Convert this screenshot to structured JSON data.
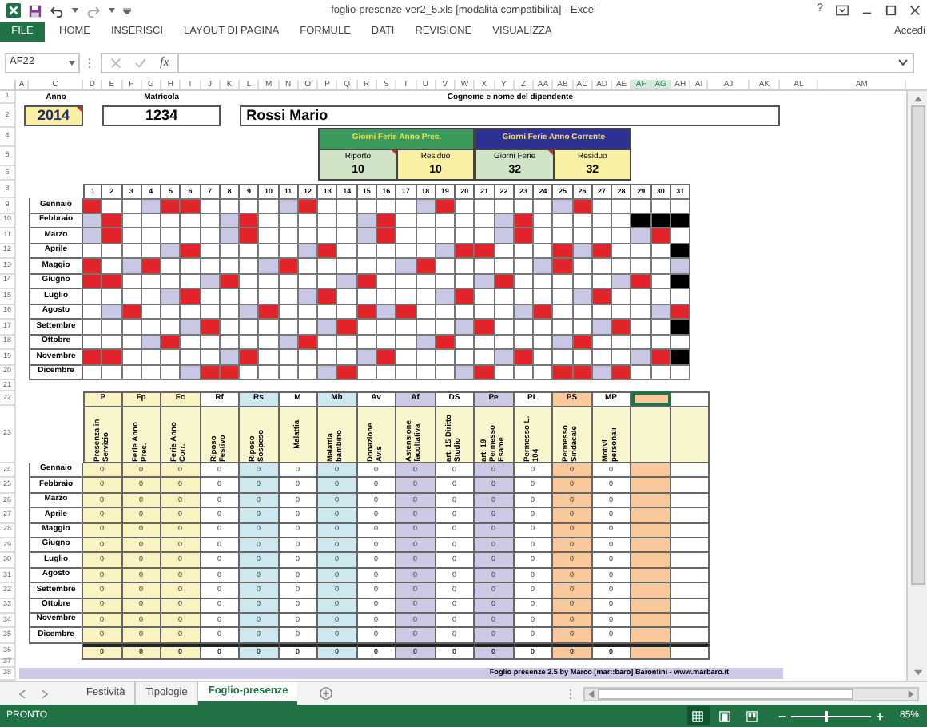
{
  "window": {
    "title": "foglio-presenze-ver2_5.xls  [modalità compatibilità] - Excel",
    "help": "?"
  },
  "ribbon": {
    "file_tab": "FILE",
    "tabs": [
      "HOME",
      "INSERISCI",
      "LAYOUT DI PAGINA",
      "FORMULE",
      "DATI",
      "REVISIONE",
      "VISUALIZZA"
    ],
    "account": "Accedi"
  },
  "formula_bar": {
    "name_box": "AF22",
    "function_label": "fx"
  },
  "columns": [
    {
      "label": "A",
      "selected": false
    },
    {
      "label": "C",
      "selected": false
    },
    {
      "label": "D",
      "selected": false
    },
    {
      "label": "E",
      "selected": false
    },
    {
      "label": "F",
      "selected": false
    },
    {
      "label": "G",
      "selected": false
    },
    {
      "label": "H",
      "selected": false
    },
    {
      "label": "I",
      "selected": false
    },
    {
      "label": "J",
      "selected": false
    },
    {
      "label": "K",
      "selected": false
    },
    {
      "label": "L",
      "selected": false
    },
    {
      "label": "M",
      "selected": false
    },
    {
      "label": "N",
      "selected": false
    },
    {
      "label": "O",
      "selected": false
    },
    {
      "label": "P",
      "selected": false
    },
    {
      "label": "Q",
      "selected": false
    },
    {
      "label": "R",
      "selected": false
    },
    {
      "label": "S",
      "selected": false
    },
    {
      "label": "T",
      "selected": false
    },
    {
      "label": "U",
      "selected": false
    },
    {
      "label": "V",
      "selected": false
    },
    {
      "label": "W",
      "selected": false
    },
    {
      "label": "X",
      "selected": false
    },
    {
      "label": "Y",
      "selected": false
    },
    {
      "label": "Z",
      "selected": false
    },
    {
      "label": "AA",
      "selected": false
    },
    {
      "label": "AB",
      "selected": false
    },
    {
      "label": "AC",
      "selected": false
    },
    {
      "label": "AD",
      "selected": false
    },
    {
      "label": "AE",
      "selected": false
    },
    {
      "label": "AF",
      "selected": true
    },
    {
      "label": "AG",
      "selected": true
    },
    {
      "label": "AH",
      "selected": false
    },
    {
      "label": "AI",
      "selected": false
    },
    {
      "label": "AJ",
      "selected": false
    },
    {
      "label": "AK",
      "selected": false
    },
    {
      "label": "AL",
      "selected": false
    },
    {
      "label": "AM",
      "selected": false
    }
  ],
  "row_numbers": [
    "1",
    "2",
    "4",
    "5",
    "6",
    "8",
    "9",
    "10",
    "11",
    "12",
    "13",
    "14",
    "15",
    "16",
    "17",
    "18",
    "19",
    "20",
    "21",
    "22",
    "23",
    "24",
    "25",
    "26",
    "27",
    "28",
    "29",
    "30",
    "31",
    "32",
    "33",
    "34",
    "35",
    "36",
    "37",
    "38"
  ],
  "header": {
    "anno": {
      "label": "Anno",
      "value": "2014",
      "comment": true
    },
    "matricola": {
      "label": "Matricola",
      "value": "1234"
    },
    "dipendente": {
      "label": "Cognome e nome del dipendente",
      "value": "Rossi Mario"
    }
  },
  "ferie": [
    {
      "title": "Giorni Ferie Anno Prec.",
      "color": "#3a9a5b",
      "fields": [
        {
          "label": "Riporto",
          "value": "10",
          "color": "#cfe3c6",
          "comment": true
        },
        {
          "label": "Residuo",
          "value": "10",
          "color": "#f7f0a3",
          "comment": false
        }
      ]
    },
    {
      "title": "Giorni Ferie Anno Corrente",
      "color": "#2e3192",
      "fields": [
        {
          "label": "Giorni Ferie",
          "value": "32",
          "color": "#cfe3c6",
          "comment": true
        },
        {
          "label": "Residuo",
          "value": "32",
          "color": "#f7f0a3",
          "comment": false
        }
      ]
    }
  ],
  "calendar": {
    "days": [
      "1",
      "2",
      "3",
      "4",
      "5",
      "6",
      "7",
      "8",
      "9",
      "10",
      "11",
      "12",
      "13",
      "14",
      "15",
      "16",
      "17",
      "18",
      "19",
      "20",
      "21",
      "22",
      "23",
      "24",
      "25",
      "26",
      "27",
      "28",
      "29",
      "30",
      "31"
    ],
    "months": [
      {
        "name": "Gennaio",
        "days": [
          {
            "kind": "hol"
          },
          {
            "kind": "work"
          },
          {
            "kind": "work"
          },
          {
            "kind": "sat"
          },
          {
            "kind": "hol"
          },
          {
            "kind": "hol"
          },
          {
            "kind": "work"
          },
          {
            "kind": "work"
          },
          {
            "kind": "work"
          },
          {
            "kind": "work"
          },
          {
            "kind": "sat"
          },
          {
            "kind": "hol"
          },
          {
            "kind": "work"
          },
          {
            "kind": "work"
          },
          {
            "kind": "work"
          },
          {
            "kind": "work"
          },
          {
            "kind": "work"
          },
          {
            "kind": "sat"
          },
          {
            "kind": "hol"
          },
          {
            "kind": "work"
          },
          {
            "kind": "work"
          },
          {
            "kind": "work"
          },
          {
            "kind": "work"
          },
          {
            "kind": "work"
          },
          {
            "kind": "sat"
          },
          {
            "kind": "hol"
          },
          {
            "kind": "work"
          },
          {
            "kind": "work"
          },
          {
            "kind": "work"
          },
          {
            "kind": "work"
          },
          {
            "kind": "work"
          }
        ]
      },
      {
        "name": "Febbraio",
        "days": [
          {
            "kind": "sat"
          },
          {
            "kind": "hol"
          },
          {
            "kind": "work"
          },
          {
            "kind": "work"
          },
          {
            "kind": "work"
          },
          {
            "kind": "work"
          },
          {
            "kind": "work"
          },
          {
            "kind": "sat"
          },
          {
            "kind": "hol"
          },
          {
            "kind": "work"
          },
          {
            "kind": "work"
          },
          {
            "kind": "work"
          },
          {
            "kind": "work"
          },
          {
            "kind": "work"
          },
          {
            "kind": "sat"
          },
          {
            "kind": "hol"
          },
          {
            "kind": "work"
          },
          {
            "kind": "work"
          },
          {
            "kind": "work"
          },
          {
            "kind": "work"
          },
          {
            "kind": "work"
          },
          {
            "kind": "sat"
          },
          {
            "kind": "hol"
          },
          {
            "kind": "work"
          },
          {
            "kind": "work"
          },
          {
            "kind": "work"
          },
          {
            "kind": "work"
          },
          {
            "kind": "work"
          },
          {
            "kind": "none"
          },
          {
            "kind": "none"
          },
          {
            "kind": "none"
          }
        ]
      },
      {
        "name": "Marzo",
        "days": [
          {
            "kind": "sat"
          },
          {
            "kind": "hol"
          },
          {
            "kind": "work"
          },
          {
            "kind": "work"
          },
          {
            "kind": "work"
          },
          {
            "kind": "work"
          },
          {
            "kind": "work"
          },
          {
            "kind": "sat"
          },
          {
            "kind": "hol"
          },
          {
            "kind": "work"
          },
          {
            "kind": "work"
          },
          {
            "kind": "work"
          },
          {
            "kind": "work"
          },
          {
            "kind": "work"
          },
          {
            "kind": "sat"
          },
          {
            "kind": "hol"
          },
          {
            "kind": "work"
          },
          {
            "kind": "work"
          },
          {
            "kind": "work"
          },
          {
            "kind": "work"
          },
          {
            "kind": "work"
          },
          {
            "kind": "sat"
          },
          {
            "kind": "hol"
          },
          {
            "kind": "work"
          },
          {
            "kind": "work"
          },
          {
            "kind": "work"
          },
          {
            "kind": "work"
          },
          {
            "kind": "work"
          },
          {
            "kind": "sat"
          },
          {
            "kind": "hol"
          },
          {
            "kind": "work"
          }
        ]
      },
      {
        "name": "Aprile",
        "days": [
          {
            "kind": "work"
          },
          {
            "kind": "work"
          },
          {
            "kind": "work"
          },
          {
            "kind": "work"
          },
          {
            "kind": "sat"
          },
          {
            "kind": "hol"
          },
          {
            "kind": "work"
          },
          {
            "kind": "work"
          },
          {
            "kind": "work"
          },
          {
            "kind": "work"
          },
          {
            "kind": "work"
          },
          {
            "kind": "sat"
          },
          {
            "kind": "hol"
          },
          {
            "kind": "work"
          },
          {
            "kind": "work"
          },
          {
            "kind": "work"
          },
          {
            "kind": "work"
          },
          {
            "kind": "work"
          },
          {
            "kind": "sat"
          },
          {
            "kind": "hol"
          },
          {
            "kind": "hol"
          },
          {
            "kind": "work"
          },
          {
            "kind": "work"
          },
          {
            "kind": "work"
          },
          {
            "kind": "hol"
          },
          {
            "kind": "sat"
          },
          {
            "kind": "hol"
          },
          {
            "kind": "work"
          },
          {
            "kind": "work"
          },
          {
            "kind": "work"
          },
          {
            "kind": "none"
          }
        ]
      },
      {
        "name": "Maggio",
        "days": [
          {
            "kind": "hol"
          },
          {
            "kind": "work"
          },
          {
            "kind": "sat"
          },
          {
            "kind": "hol"
          },
          {
            "kind": "work"
          },
          {
            "kind": "work"
          },
          {
            "kind": "work"
          },
          {
            "kind": "work"
          },
          {
            "kind": "work"
          },
          {
            "kind": "sat"
          },
          {
            "kind": "hol"
          },
          {
            "kind": "work"
          },
          {
            "kind": "work"
          },
          {
            "kind": "work"
          },
          {
            "kind": "work"
          },
          {
            "kind": "work"
          },
          {
            "kind": "sat"
          },
          {
            "kind": "hol"
          },
          {
            "kind": "work"
          },
          {
            "kind": "work"
          },
          {
            "kind": "work"
          },
          {
            "kind": "work"
          },
          {
            "kind": "work"
          },
          {
            "kind": "sat"
          },
          {
            "kind": "hol"
          },
          {
            "kind": "work"
          },
          {
            "kind": "work"
          },
          {
            "kind": "work"
          },
          {
            "kind": "work"
          },
          {
            "kind": "work"
          },
          {
            "kind": "sat"
          }
        ]
      },
      {
        "name": "Giugno",
        "days": [
          {
            "kind": "hol"
          },
          {
            "kind": "hol"
          },
          {
            "kind": "work"
          },
          {
            "kind": "work"
          },
          {
            "kind": "work"
          },
          {
            "kind": "work"
          },
          {
            "kind": "sat"
          },
          {
            "kind": "hol"
          },
          {
            "kind": "work"
          },
          {
            "kind": "work"
          },
          {
            "kind": "work"
          },
          {
            "kind": "work"
          },
          {
            "kind": "work"
          },
          {
            "kind": "sat"
          },
          {
            "kind": "hol"
          },
          {
            "kind": "work"
          },
          {
            "kind": "work"
          },
          {
            "kind": "work"
          },
          {
            "kind": "work"
          },
          {
            "kind": "work"
          },
          {
            "kind": "sat"
          },
          {
            "kind": "hol"
          },
          {
            "kind": "work"
          },
          {
            "kind": "work"
          },
          {
            "kind": "work"
          },
          {
            "kind": "work"
          },
          {
            "kind": "work"
          },
          {
            "kind": "sat"
          },
          {
            "kind": "hol"
          },
          {
            "kind": "work"
          },
          {
            "kind": "none"
          }
        ]
      },
      {
        "name": "Luglio",
        "days": [
          {
            "kind": "work"
          },
          {
            "kind": "work"
          },
          {
            "kind": "work"
          },
          {
            "kind": "work"
          },
          {
            "kind": "sat"
          },
          {
            "kind": "hol"
          },
          {
            "kind": "work"
          },
          {
            "kind": "work"
          },
          {
            "kind": "work"
          },
          {
            "kind": "work"
          },
          {
            "kind": "work"
          },
          {
            "kind": "sat"
          },
          {
            "kind": "hol"
          },
          {
            "kind": "work"
          },
          {
            "kind": "work"
          },
          {
            "kind": "work"
          },
          {
            "kind": "work"
          },
          {
            "kind": "work"
          },
          {
            "kind": "sat"
          },
          {
            "kind": "hol"
          },
          {
            "kind": "work"
          },
          {
            "kind": "work"
          },
          {
            "kind": "work"
          },
          {
            "kind": "work"
          },
          {
            "kind": "work"
          },
          {
            "kind": "sat"
          },
          {
            "kind": "hol"
          },
          {
            "kind": "work"
          },
          {
            "kind": "work"
          },
          {
            "kind": "work"
          },
          {
            "kind": "work"
          }
        ]
      },
      {
        "name": "Agosto",
        "days": [
          {
            "kind": "work"
          },
          {
            "kind": "sat"
          },
          {
            "kind": "hol"
          },
          {
            "kind": "work"
          },
          {
            "kind": "work"
          },
          {
            "kind": "work"
          },
          {
            "kind": "work"
          },
          {
            "kind": "work"
          },
          {
            "kind": "sat"
          },
          {
            "kind": "hol"
          },
          {
            "kind": "work"
          },
          {
            "kind": "work"
          },
          {
            "kind": "work"
          },
          {
            "kind": "work"
          },
          {
            "kind": "hol"
          },
          {
            "kind": "sat"
          },
          {
            "kind": "hol"
          },
          {
            "kind": "work"
          },
          {
            "kind": "work"
          },
          {
            "kind": "work"
          },
          {
            "kind": "work"
          },
          {
            "kind": "work"
          },
          {
            "kind": "sat"
          },
          {
            "kind": "hol"
          },
          {
            "kind": "work"
          },
          {
            "kind": "work"
          },
          {
            "kind": "work"
          },
          {
            "kind": "work"
          },
          {
            "kind": "work"
          },
          {
            "kind": "sat"
          },
          {
            "kind": "hol"
          }
        ]
      },
      {
        "name": "Settembre",
        "days": [
          {
            "kind": "work"
          },
          {
            "kind": "work"
          },
          {
            "kind": "work"
          },
          {
            "kind": "work"
          },
          {
            "kind": "work"
          },
          {
            "kind": "sat"
          },
          {
            "kind": "hol"
          },
          {
            "kind": "work"
          },
          {
            "kind": "work"
          },
          {
            "kind": "work"
          },
          {
            "kind": "work"
          },
          {
            "kind": "work"
          },
          {
            "kind": "sat"
          },
          {
            "kind": "hol"
          },
          {
            "kind": "work"
          },
          {
            "kind": "work"
          },
          {
            "kind": "work"
          },
          {
            "kind": "work"
          },
          {
            "kind": "work"
          },
          {
            "kind": "sat"
          },
          {
            "kind": "hol"
          },
          {
            "kind": "work"
          },
          {
            "kind": "work"
          },
          {
            "kind": "work"
          },
          {
            "kind": "work"
          },
          {
            "kind": "work"
          },
          {
            "kind": "sat"
          },
          {
            "kind": "hol"
          },
          {
            "kind": "work"
          },
          {
            "kind": "work"
          },
          {
            "kind": "none"
          }
        ]
      },
      {
        "name": "Ottobre",
        "days": [
          {
            "kind": "work"
          },
          {
            "kind": "work"
          },
          {
            "kind": "work"
          },
          {
            "kind": "sat"
          },
          {
            "kind": "hol"
          },
          {
            "kind": "work"
          },
          {
            "kind": "work"
          },
          {
            "kind": "work"
          },
          {
            "kind": "work"
          },
          {
            "kind": "work"
          },
          {
            "kind": "sat"
          },
          {
            "kind": "hol"
          },
          {
            "kind": "work"
          },
          {
            "kind": "work"
          },
          {
            "kind": "work"
          },
          {
            "kind": "work"
          },
          {
            "kind": "work"
          },
          {
            "kind": "sat"
          },
          {
            "kind": "hol"
          },
          {
            "kind": "work"
          },
          {
            "kind": "work"
          },
          {
            "kind": "work"
          },
          {
            "kind": "work"
          },
          {
            "kind": "work"
          },
          {
            "kind": "sat"
          },
          {
            "kind": "hol"
          },
          {
            "kind": "work"
          },
          {
            "kind": "work"
          },
          {
            "kind": "work"
          },
          {
            "kind": "work"
          },
          {
            "kind": "work"
          }
        ]
      },
      {
        "name": "Novembre",
        "days": [
          {
            "kind": "hol"
          },
          {
            "kind": "hol"
          },
          {
            "kind": "work"
          },
          {
            "kind": "work"
          },
          {
            "kind": "work"
          },
          {
            "kind": "work"
          },
          {
            "kind": "work"
          },
          {
            "kind": "sat"
          },
          {
            "kind": "hol"
          },
          {
            "kind": "work"
          },
          {
            "kind": "work"
          },
          {
            "kind": "work"
          },
          {
            "kind": "work"
          },
          {
            "kind": "work"
          },
          {
            "kind": "sat"
          },
          {
            "kind": "hol"
          },
          {
            "kind": "work"
          },
          {
            "kind": "work"
          },
          {
            "kind": "work"
          },
          {
            "kind": "work"
          },
          {
            "kind": "work"
          },
          {
            "kind": "sat"
          },
          {
            "kind": "hol"
          },
          {
            "kind": "work"
          },
          {
            "kind": "work"
          },
          {
            "kind": "work"
          },
          {
            "kind": "work"
          },
          {
            "kind": "work"
          },
          {
            "kind": "sat"
          },
          {
            "kind": "hol"
          },
          {
            "kind": "none"
          }
        ]
      },
      {
        "name": "Dicembre",
        "days": [
          {
            "kind": "work"
          },
          {
            "kind": "work"
          },
          {
            "kind": "work"
          },
          {
            "kind": "work"
          },
          {
            "kind": "work"
          },
          {
            "kind": "sat"
          },
          {
            "kind": "hol"
          },
          {
            "kind": "hol"
          },
          {
            "kind": "work"
          },
          {
            "kind": "work"
          },
          {
            "kind": "work"
          },
          {
            "kind": "work"
          },
          {
            "kind": "sat"
          },
          {
            "kind": "hol"
          },
          {
            "kind": "work"
          },
          {
            "kind": "work"
          },
          {
            "kind": "work"
          },
          {
            "kind": "work"
          },
          {
            "kind": "work"
          },
          {
            "kind": "sat"
          },
          {
            "kind": "hol"
          },
          {
            "kind": "work"
          },
          {
            "kind": "work"
          },
          {
            "kind": "work"
          },
          {
            "kind": "hol"
          },
          {
            "kind": "hol"
          },
          {
            "kind": "sat"
          },
          {
            "kind": "hol"
          },
          {
            "kind": "work"
          },
          {
            "kind": "work"
          },
          {
            "kind": "work"
          }
        ]
      }
    ]
  },
  "summary": {
    "columns": [
      {
        "code": "P",
        "label": "Presenza in Servizio",
        "color": "#f8f3c0",
        "selected": false
      },
      {
        "code": "Fp",
        "label": "Ferie Anno Prec.",
        "color": "#f8f3c0",
        "selected": false
      },
      {
        "code": "Fc",
        "label": "Ferie Anno Corr.",
        "color": "#f8f3c0",
        "selected": false
      },
      {
        "code": "Rf",
        "label": "Riposo Festivo",
        "color": "#ffffff",
        "selected": false
      },
      {
        "code": "Rs",
        "label": "Riposo Sospeso",
        "color": "#cde8ef",
        "selected": false
      },
      {
        "code": "M",
        "label": "Malattia",
        "color": "#ffffff",
        "selected": false
      },
      {
        "code": "Mb",
        "label": "Malattia bambino",
        "color": "#cde8ef",
        "selected": false
      },
      {
        "code": "Av",
        "label": "Donazione Avis",
        "color": "#ffffff",
        "selected": false
      },
      {
        "code": "Af",
        "label": "Astensione facoltativa",
        "color": "#cbc9e3",
        "selected": false
      },
      {
        "code": "DS",
        "label": "art. 15 Diritto Studio",
        "color": "#ffffff",
        "selected": false
      },
      {
        "code": "Pe",
        "label": "art. 19 Permesso Esame",
        "color": "#cbc9e3",
        "selected": false
      },
      {
        "code": "PL",
        "label": "Permesso L. 104",
        "color": "#ffffff",
        "selected": false
      },
      {
        "code": "PS",
        "label": "Permesso Sindacale",
        "color": "#f9c89b",
        "selected": false
      },
      {
        "code": "MP",
        "label": "Motivi personali",
        "color": "#ffffff",
        "selected": false
      },
      {
        "color": "#f9c89b",
        "selected": true
      },
      {
        "color": "#ffffff",
        "selected": false
      }
    ],
    "rows": [
      {
        "month": "Gennaio",
        "values": [
          "0",
          "0",
          "0",
          "0",
          "0",
          "0",
          "0",
          "0",
          "0",
          "0",
          "0",
          "0",
          "0",
          "0"
        ]
      },
      {
        "month": "Febbraio",
        "values": [
          "0",
          "0",
          "0",
          "0",
          "0",
          "0",
          "0",
          "0",
          "0",
          "0",
          "0",
          "0",
          "0",
          "0"
        ]
      },
      {
        "month": "Marzo",
        "values": [
          "0",
          "0",
          "0",
          "0",
          "0",
          "0",
          "0",
          "0",
          "0",
          "0",
          "0",
          "0",
          "0",
          "0"
        ]
      },
      {
        "month": "Aprile",
        "values": [
          "0",
          "0",
          "0",
          "0",
          "0",
          "0",
          "0",
          "0",
          "0",
          "0",
          "0",
          "0",
          "0",
          "0"
        ]
      },
      {
        "month": "Maggio",
        "values": [
          "0",
          "0",
          "0",
          "0",
          "0",
          "0",
          "0",
          "0",
          "0",
          "0",
          "0",
          "0",
          "0",
          "0"
        ]
      },
      {
        "month": "Giugno",
        "values": [
          "0",
          "0",
          "0",
          "0",
          "0",
          "0",
          "0",
          "0",
          "0",
          "0",
          "0",
          "0",
          "0",
          "0"
        ]
      },
      {
        "month": "Luglio",
        "values": [
          "0",
          "0",
          "0",
          "0",
          "0",
          "0",
          "0",
          "0",
          "0",
          "0",
          "0",
          "0",
          "0",
          "0"
        ]
      },
      {
        "month": "Agosto",
        "values": [
          "0",
          "0",
          "0",
          "0",
          "0",
          "0",
          "0",
          "0",
          "0",
          "0",
          "0",
          "0",
          "0",
          "0"
        ]
      },
      {
        "month": "Settembre",
        "values": [
          "0",
          "0",
          "0",
          "0",
          "0",
          "0",
          "0",
          "0",
          "0",
          "0",
          "0",
          "0",
          "0",
          "0"
        ]
      },
      {
        "month": "Ottobre",
        "values": [
          "0",
          "0",
          "0",
          "0",
          "0",
          "0",
          "0",
          "0",
          "0",
          "0",
          "0",
          "0",
          "0",
          "0"
        ]
      },
      {
        "month": "Novembre",
        "values": [
          "0",
          "0",
          "0",
          "0",
          "0",
          "0",
          "0",
          "0",
          "0",
          "0",
          "0",
          "0",
          "0",
          "0"
        ]
      },
      {
        "month": "Dicembre",
        "values": [
          "0",
          "0",
          "0",
          "0",
          "0",
          "0",
          "0",
          "0",
          "0",
          "0",
          "0",
          "0",
          "0",
          "0"
        ]
      }
    ],
    "totals": [
      "0",
      "0",
      "0",
      "0",
      "0",
      "0",
      "0",
      "0",
      "0",
      "0",
      "0",
      "0",
      "0",
      "0"
    ]
  },
  "footer": "Foglio presenze 2.5 by Marco [mar::baro] Barontini - www.marbaro.it",
  "sheet_tabs": [
    {
      "label": "Festività",
      "selected": false
    },
    {
      "label": "Tipologie",
      "selected": false
    },
    {
      "label": "Foglio-presenze",
      "selected": true
    }
  ],
  "status_bar": {
    "status": "PRONTO",
    "views": [
      {
        "kind": "normal",
        "selected": true
      },
      {
        "kind": "layout",
        "selected": false
      },
      {
        "kind": "pagebreak",
        "selected": false
      }
    ],
    "zoom": {
      "label": "85%",
      "level": 0.44
    }
  }
}
